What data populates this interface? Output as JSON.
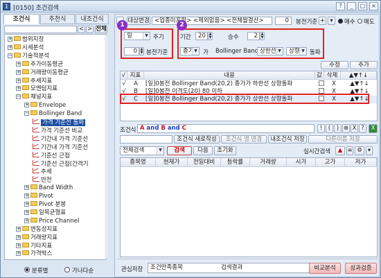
{
  "window": {
    "title": "[0150] 조건검색",
    "icon": "1"
  },
  "tabs": [
    {
      "label": "조건식"
    },
    {
      "label": "추천식"
    },
    {
      "label": "내조건식"
    }
  ],
  "sidebar": {
    "search_btn": "전체",
    "tree": [
      {
        "label": "범위지정",
        "level": 0,
        "pm": "+"
      },
      {
        "label": "시세분석",
        "level": 0,
        "pm": "+"
      },
      {
        "label": "기술적분석",
        "level": 0,
        "pm": "−"
      },
      {
        "label": "주가이동평균",
        "level": 1,
        "pm": "+"
      },
      {
        "label": "거래량이동평균",
        "level": 1,
        "pm": "+"
      },
      {
        "label": "추세지표",
        "level": 1,
        "pm": "+"
      },
      {
        "label": "모멘텀지표",
        "level": 1,
        "pm": "+"
      },
      {
        "label": "채널지표",
        "level": 1,
        "pm": "−"
      },
      {
        "label": "Envelope",
        "level": 2,
        "pm": "+"
      },
      {
        "label": "Bollinger Band",
        "level": 2,
        "pm": "−"
      },
      {
        "label": "가격 기준선 돌파",
        "level": 3,
        "leaf": true,
        "selected": true
      },
      {
        "label": "가격 기준선 비교",
        "level": 3,
        "leaf": true
      },
      {
        "label": "기간내 가격 기준선",
        "level": 3,
        "leaf": true
      },
      {
        "label": "기간내 가격 기준선",
        "level": 3,
        "leaf": true
      },
      {
        "label": "기준선 근접",
        "level": 3,
        "leaf": true
      },
      {
        "label": "기준선 근접(간격기",
        "level": 3,
        "leaf": true
      },
      {
        "label": "추세",
        "level": 3,
        "leaf": true
      },
      {
        "label": "반전",
        "level": 3,
        "leaf": true
      },
      {
        "label": "Band Width",
        "level": 2,
        "pm": "+"
      },
      {
        "label": "Pivot",
        "level": 2,
        "pm": "+"
      },
      {
        "label": "Pivot 분봉",
        "level": 2,
        "pm": "+"
      },
      {
        "label": "일목균형표",
        "level": 2,
        "pm": "+"
      },
      {
        "label": "Price Channel",
        "level": 2,
        "pm": "+"
      },
      {
        "label": "변동성지표",
        "level": 1,
        "pm": "+"
      },
      {
        "label": "거래량지표",
        "level": 1,
        "pm": "+"
      },
      {
        "label": "기타지표",
        "level": 1,
        "pm": "+"
      },
      {
        "label": "가격박스",
        "level": 1,
        "pm": "+"
      }
    ],
    "radio1": "분류별",
    "radio2": "가나다순"
  },
  "toolbar": {
    "target_label": "대상변경",
    "target_value": "<업종미포함> <제외없음> <전체월결산>",
    "spin_value": "0",
    "chart_type": "봉전기준",
    "buy_label": "매수",
    "sell_label": "매도"
  },
  "params": {
    "period_value": "일",
    "cycle_label": "주기",
    "offset_value": "0",
    "offset_label": "봉전기준",
    "term_label": "기간",
    "term_value": "20",
    "mult_label": "승수",
    "mult_value": "2",
    "price_value": "종가",
    "ga": "가",
    "band_text": "Bollinger Band",
    "band_line": "상한선",
    "direction": "상향",
    "breakout": "돌파"
  },
  "buttons": {
    "edit": "수정",
    "add": "추가"
  },
  "cond_table": {
    "headers": [
      "√",
      "지표",
      "내용",
      "값",
      "삭제",
      "▲▼↑↓"
    ],
    "rows": [
      {
        "check": "√",
        "id": "A",
        "content": "[일]0봉전 Bollinger Band(20,2) 종가가 하한선 상향돌파",
        "del": "X"
      },
      {
        "check": "√",
        "id": "B",
        "content": "[일]0봉전 이격도(20) 80 이하",
        "del": "X"
      },
      {
        "check": "√",
        "id": "C",
        "content": "[일]0봉전 Bollinger Band(20,2) 종가가 상한선 상향돌파",
        "del": "X"
      }
    ]
  },
  "formula": {
    "label": "조건식",
    "value": "A and B and C",
    "ops": [
      "!",
      "(",
      ")",
      "⊗",
      "X",
      "?"
    ]
  },
  "save_row": {
    "new_save": "조건식 새로작성",
    "change": "조건식 명 변경",
    "save": "내조건식 저장",
    "save_as": "다른이름 저장"
  },
  "search": {
    "scope": "전체검색",
    "search_btn": "검색",
    "next_btn": "다음",
    "reset_btn": "초기화",
    "realtime": "실시간검색"
  },
  "result_table": {
    "headers": [
      "종목명",
      "현재가",
      "전일대비",
      "등락률",
      "거래량",
      "시가",
      "고가",
      "저가"
    ]
  },
  "bottom": {
    "interest": "관심저장",
    "cond_count": "조건만족종목",
    "result": "검색결과",
    "compare": "비교분석",
    "verify": "성과검증"
  },
  "colors": {
    "highlight": "#e02020",
    "badge": "#8b2fc9",
    "accent_red": "#d82020",
    "accent_blue": "#1a3cc8"
  }
}
